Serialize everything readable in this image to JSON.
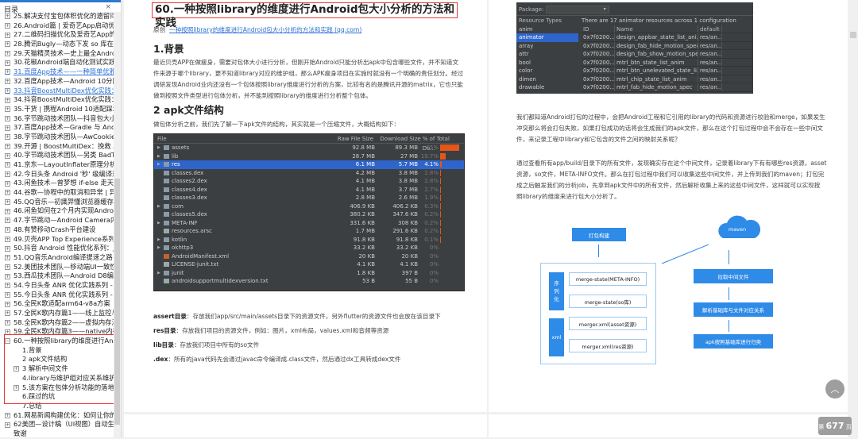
{
  "sidebar": {
    "title": "目录",
    "close": "×",
    "items": [
      {
        "label": "25.解决支付宝包体积优化的遗留问题：运",
        "exp": true
      },
      {
        "label": "26.Android篇 | 爱奇艺App启动优化实践",
        "exp": true
      },
      {
        "label": "27.二维码扫描优化及爱奇艺App的实践",
        "exp": true
      },
      {
        "label": "28.腾讯Bugly—动态下发 so 库在 Andro",
        "exp": true
      },
      {
        "label": "29.天猫精灵技术—史上最全Android渲染",
        "exp": true
      },
      {
        "label": "30.花椒Android端自动化测试实践",
        "exp": true
      },
      {
        "label": "31.百度App技术——一种简单优雅的TextV",
        "exp": true,
        "link": true
      },
      {
        "label": "32.百度App技术—Android 10分区存储",
        "exp": true
      },
      {
        "label": "33.抖音BoostMultiDex优化实践：Andro",
        "exp": true,
        "link": true
      },
      {
        "label": "34.抖音BoostMultiDex优化实践：Andro",
        "exp": true
      },
      {
        "label": "35.干货 | 携程Android 10适配踩坑指南",
        "exp": true
      },
      {
        "label": "36.字节跳动技术团队—抖音包大小优化-",
        "exp": true
      },
      {
        "label": "37.百度App技术—Gradle 与 Android 构",
        "exp": true
      },
      {
        "label": "38.字节跳动技术团队—AwCookieManag",
        "exp": true
      },
      {
        "label": "39.开源 | BoostMultiDex：挽救 Android",
        "exp": true
      },
      {
        "label": "40.字节跳动技术团队—另类 BadTokenE",
        "exp": true
      },
      {
        "label": "41.京东—LayoutInflater原理分析与复你",
        "exp": true
      },
      {
        "label": "42.今日头条 Android '秒' 级编译速度优化",
        "exp": true
      },
      {
        "label": "43.闲鱼技术—曾梦想 if-else 走天涯？看",
        "exp": true
      },
      {
        "label": "44.谷歌—协程中的取消和异常 | 异常处理",
        "exp": true
      },
      {
        "label": "45.QQ音乐—初識羿懂浏览器缓存策略",
        "exp": true
      },
      {
        "label": "46.闲鱼如何在2个月内实现Android启动",
        "exp": true
      },
      {
        "label": "47.字节跳动—Android Camera内存问题",
        "exp": true
      },
      {
        "label": "48.有赞移动Crash平台建设",
        "exp": true
      },
      {
        "label": "49.贝壳APP Top Experience系列 | Andr",
        "exp": true
      },
      {
        "label": "50.抖音 Android 性能优化系列：Java 内",
        "exp": true
      },
      {
        "label": "51.QQ音乐Android编译提速之路",
        "exp": true
      },
      {
        "label": "52.美团技术团队—移动端UI一致性解决方",
        "exp": true
      },
      {
        "label": "53.西瓜技术团队—Android D8编译器\"b",
        "exp": true
      },
      {
        "label": "54.今日头条 ANR 优化实践系列 - 设计原",
        "exp": true
      },
      {
        "label": "55.今日头条 ANR 优化实践系列 - 监控工",
        "exp": true
      },
      {
        "label": "56.全民K歌适配arm64-v8a方案",
        "exp": true
      },
      {
        "label": "57.全民K歌内存篇1——线上监控与综合治",
        "exp": true
      },
      {
        "label": "58.全民K歌内存篇2——虚拟内存浅析",
        "exp": true
      },
      {
        "label": "59.全民K歌内存篇3——native内存分析与",
        "exp": true
      },
      {
        "label": "60.一种按照library的维度进行Android包",
        "exp": true,
        "open": true
      },
      {
        "label": "1.背景",
        "child": true
      },
      {
        "label": "2 apk文件结构",
        "child": true
      },
      {
        "label": "3 解析中间文件",
        "child": true,
        "exp": true
      },
      {
        "label": "4.library与维护组对应关系维护",
        "child": true
      },
      {
        "label": "5.该方案在包体分析功能的落地",
        "child": true,
        "exp": true
      },
      {
        "label": "6.踩过的坑",
        "child": true
      },
      {
        "label": "7.总结",
        "child": true
      },
      {
        "label": "61.网易新闻构建优化：如何让你的构建速",
        "exp": true
      },
      {
        "label": "62美团—设计稿（UI视图）自动生成代码",
        "exp": true
      },
      {
        "label": "致谢"
      }
    ]
  },
  "page1": {
    "title": "60.一种按照library的维度进行Android包大小分析的方法和实践",
    "source_prefix": "原创",
    "source_link": "一种按照library的维度进行Android包大小分析的方法和实践 (qq.com)",
    "h_background": "1.背景",
    "p_background": [
      "最近贝壳APP在做瘦身，需要对包体大小进行分析，但刚开始Android只能分析出apk中包含哪些文件，并不知道文",
      "件来源于哪个library，更不知道library对应的维护组，那么APK瘦身项目在实施时就没有一个明确的责任划分。经过",
      "调研发现Android业内还没有一个包体按照library维度进行分析的方案，比较有名的是腾讯开源的matrix，它也只能",
      "做到按照文件类型进行包体分析，并不能到按照library的维度进行分析整个包体。"
    ],
    "h_apk": "2 apk文件结构",
    "p_apk": "做包体分析之前，我们先了解一下apk文件的结构，其实就是一个压缩文件，大概结构如下：",
    "apk_table": {
      "headers": [
        "File",
        "Raw File Size",
        "Download Size",
        "% of Total Do..."
      ],
      "rows": [
        {
          "name": "assets",
          "type": "folder",
          "raw": "92.8 MB",
          "dl": "89.3 MB",
          "pct": "65%",
          "share": 65
        },
        {
          "name": "lib",
          "type": "folder",
          "raw": "28.7 MB",
          "dl": "27 MB",
          "pct": "19.7%",
          "share": 19.7
        },
        {
          "name": "res",
          "type": "folder",
          "raw": "6.1 MB",
          "dl": "5.7 MB",
          "pct": "4.1%",
          "share": 4.1,
          "selected": true
        },
        {
          "name": "classes.dex",
          "type": "dex",
          "raw": "4.2 MB",
          "dl": "3.8 MB",
          "pct": "2.8%",
          "share": 2.8
        },
        {
          "name": "classes2.dex",
          "type": "dex",
          "raw": "4.1 MB",
          "dl": "3.8 MB",
          "pct": "2.8%",
          "share": 2.8
        },
        {
          "name": "classes4.dex",
          "type": "dex",
          "raw": "4.1 MB",
          "dl": "3.7 MB",
          "pct": "2.7%",
          "share": 2.7
        },
        {
          "name": "classes3.dex",
          "type": "dex",
          "raw": "2.8 MB",
          "dl": "2.6 MB",
          "pct": "1.9%",
          "share": 1.9
        },
        {
          "name": "com",
          "type": "folder",
          "raw": "406.9 KB",
          "dl": "406.2 KB",
          "pct": "0.3%",
          "share": 0.3
        },
        {
          "name": "classes5.dex",
          "type": "dex",
          "raw": "380.2 KB",
          "dl": "347.6 KB",
          "pct": "0.2%",
          "share": 0.2
        },
        {
          "name": "META-INF",
          "type": "folder",
          "raw": "331.6 KB",
          "dl": "308 KB",
          "pct": "0.2%",
          "share": 0.2
        },
        {
          "name": "resources.arsc",
          "type": "file",
          "raw": "1.7 MB",
          "dl": "291.6 KB",
          "pct": "0.2%",
          "share": 0.2
        },
        {
          "name": "kotlin",
          "type": "folder",
          "raw": "91.8 KB",
          "dl": "91.8 KB",
          "pct": "0.1%",
          "share": 0.1
        },
        {
          "name": "okhttp3",
          "type": "folder",
          "raw": "33.2 KB",
          "dl": "33.2 KB",
          "pct": "0%",
          "share": 0
        },
        {
          "name": "AndroidManifest.xml",
          "type": "xml",
          "raw": "20 KB",
          "dl": "20 KB",
          "pct": "0%",
          "share": 0
        },
        {
          "name": "LICENSE-junit.txt",
          "type": "file",
          "raw": "4.1 KB",
          "dl": "4.1 KB",
          "pct": "0%",
          "share": 0
        },
        {
          "name": "junit",
          "type": "folder",
          "raw": "1.8 KB",
          "dl": "397 B",
          "pct": "0%",
          "share": 0
        },
        {
          "name": "androidsupportmultidexversion.txt",
          "type": "file",
          "raw": "53 B",
          "dl": "55 B",
          "pct": "0%",
          "share": 0
        }
      ]
    },
    "defs": [
      {
        "term": "assert目录",
        "text": "：存放我们app/src/main/assets目录下的资源文件，另外flutter的资源文件也会放在该目录下"
      },
      {
        "term": "res目录",
        "text": "：存放我们项目的资源文件，例如：图片，xml布局，values.xml和音频等资源"
      },
      {
        "term": "lib目录",
        "text": "：存放我们项目中所有的so文件"
      },
      {
        "term": ".dex",
        "text": "：所有的java代码先会通过javac命令编译成.class文件，然后通过dx工具转成dex文件"
      }
    ]
  },
  "page2": {
    "resources": {
      "package_label": "Package:",
      "types_label": "Resource Types",
      "summary": "There are 17 animator resources across 1 configuration",
      "types": [
        "anim",
        "animator",
        "array",
        "attr",
        "bool",
        "color",
        "dimen",
        "drawable"
      ],
      "selected_type": "animator",
      "columns": [
        "ID",
        "Name",
        "default"
      ],
      "rows": [
        [
          "0x7f0200...",
          "design_appbar_state_list_ani...",
          "res/an..."
        ],
        [
          "0x7f0200...",
          "design_fab_hide_motion_spec",
          "res/an..."
        ],
        [
          "0x7f0200...",
          "design_fab_show_motion_spec",
          "res/an..."
        ],
        [
          "0x7f0200...",
          "mtrl_btn_state_list_anim",
          "res/an..."
        ],
        [
          "0x7f0200...",
          "mtrl_btn_unelevated_state_li...",
          "res/an..."
        ],
        [
          "0x7f0200...",
          "mtrl_chip_state_list_anim",
          "res/an..."
        ],
        [
          "0x7f0200...",
          "mtrl_fab_hide_motion_spec",
          "res/an..."
        ]
      ]
    },
    "p1": [
      "我们都知道Android打包的过程中，会把Android工程和它引用的library的代码和资源进行校验和merge，如果发生",
      "冲突那么将会打包失败，如果打包成功的话将会生成我们的apk文件，那么在这个打包过程中会不会存在一些中间文",
      "件，来记录工程中library和它包含的文件之间的映射关系呢？"
    ],
    "p2": [
      "通过查看所有app/build/目录下的所有文件，发现确实存在这个中间文件，记录着library下有有哪些res资源，asset",
      "资源，so文件，META-INFO文件。那么在打包过程中我们可以收集这些中间文件，并上传到我们的maven；打包完",
      "成之后触发我们的分析job，先拿到apk文件中的所有文件，然后解析收集上来的这些中间文件，这样就可以实现按",
      "照library的维度来进行包大小分析了。"
    ],
    "diagram": {
      "build": "打包构建",
      "serial": "序\n列\n化",
      "xml": "xml",
      "merge1": "merge-state(META-INFO)",
      "merge2": "merge-state(so库)",
      "merge3": "merger.xml(asset资源)",
      "merge4": "merger.xml(res资源)",
      "maven": "maven",
      "pull": "拉取中间文件",
      "parse": "解析基础库与文件对应关系",
      "classify": "apk按照基础库进行归类",
      "color": "#2f8be8"
    }
  },
  "page_indicator": {
    "prefix": "第",
    "number": "677",
    "suffix": "页"
  },
  "colors": {
    "accent": "#2b79d0",
    "highlight": "#e53935",
    "link": "#2b6fd6",
    "bar": "#e4561a",
    "selection": "#2f65ca"
  }
}
